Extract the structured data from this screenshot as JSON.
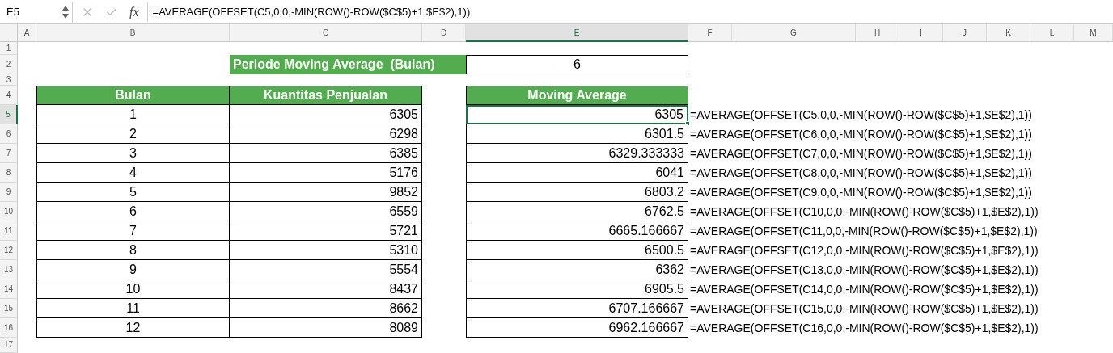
{
  "formula_bar": {
    "name_box": "E5",
    "fx": "fx",
    "formula": "=AVERAGE(OFFSET(C5,0,0,-MIN(ROW()-ROW($C$5)+1,$E$2),1))"
  },
  "columns": [
    {
      "label": "A",
      "selected": false
    },
    {
      "label": "B",
      "selected": false
    },
    {
      "label": "C",
      "selected": false
    },
    {
      "label": "D",
      "selected": false
    },
    {
      "label": "E",
      "selected": true
    },
    {
      "label": "F",
      "selected": false
    },
    {
      "label": "G",
      "selected": false
    },
    {
      "label": "H",
      "selected": false
    },
    {
      "label": "I",
      "selected": false
    },
    {
      "label": "J",
      "selected": false
    },
    {
      "label": "K",
      "selected": false
    },
    {
      "label": "L",
      "selected": false
    },
    {
      "label": "M",
      "selected": false
    }
  ],
  "row_numbers": [
    {
      "label": "1",
      "selected": false
    },
    {
      "label": "2",
      "selected": false
    },
    {
      "label": "3",
      "selected": false
    },
    {
      "label": "4",
      "selected": false
    },
    {
      "label": "5",
      "selected": true
    },
    {
      "label": "6",
      "selected": false
    },
    {
      "label": "7",
      "selected": false
    },
    {
      "label": "8",
      "selected": false
    },
    {
      "label": "9",
      "selected": false
    },
    {
      "label": "10",
      "selected": false
    },
    {
      "label": "11",
      "selected": false
    },
    {
      "label": "12",
      "selected": false
    },
    {
      "label": "13",
      "selected": false
    },
    {
      "label": "14",
      "selected": false
    },
    {
      "label": "15",
      "selected": false
    },
    {
      "label": "16",
      "selected": false
    },
    {
      "label": "17",
      "selected": false
    }
  ],
  "period": {
    "label": "Periode Moving Average  (Bulan)",
    "value": "6"
  },
  "sales_table": {
    "columns": [
      "Bulan",
      "Kuantitas Penjualan"
    ],
    "rows": [
      [
        "1",
        "6305"
      ],
      [
        "2",
        "6298"
      ],
      [
        "3",
        "6385"
      ],
      [
        "4",
        "5176"
      ],
      [
        "5",
        "9852"
      ],
      [
        "6",
        "6559"
      ],
      [
        "7",
        "5721"
      ],
      [
        "8",
        "5310"
      ],
      [
        "9",
        "5554"
      ],
      [
        "10",
        "8437"
      ],
      [
        "11",
        "8662"
      ],
      [
        "12",
        "8089"
      ]
    ]
  },
  "moving_average": {
    "header": "Moving Average",
    "rows": [
      {
        "value": "6305",
        "formula": "=AVERAGE(OFFSET(C5,0,0,-MIN(ROW()-ROW($C$5)+1,$E$2),1))",
        "selected": true
      },
      {
        "value": "6301.5",
        "formula": "=AVERAGE(OFFSET(C6,0,0,-MIN(ROW()-ROW($C$5)+1,$E$2),1))",
        "selected": false
      },
      {
        "value": "6329.333333",
        "formula": "=AVERAGE(OFFSET(C7,0,0,-MIN(ROW()-ROW($C$5)+1,$E$2),1))",
        "selected": false
      },
      {
        "value": "6041",
        "formula": "=AVERAGE(OFFSET(C8,0,0,-MIN(ROW()-ROW($C$5)+1,$E$2),1))",
        "selected": false
      },
      {
        "value": "6803.2",
        "formula": "=AVERAGE(OFFSET(C9,0,0,-MIN(ROW()-ROW($C$5)+1,$E$2),1))",
        "selected": false
      },
      {
        "value": "6762.5",
        "formula": "=AVERAGE(OFFSET(C10,0,0,-MIN(ROW()-ROW($C$5)+1,$E$2),1))",
        "selected": false
      },
      {
        "value": "6665.166667",
        "formula": "=AVERAGE(OFFSET(C11,0,0,-MIN(ROW()-ROW($C$5)+1,$E$2),1))",
        "selected": false
      },
      {
        "value": "6500.5",
        "formula": "=AVERAGE(OFFSET(C12,0,0,-MIN(ROW()-ROW($C$5)+1,$E$2),1))",
        "selected": false
      },
      {
        "value": "6362",
        "formula": "=AVERAGE(OFFSET(C13,0,0,-MIN(ROW()-ROW($C$5)+1,$E$2),1))",
        "selected": false
      },
      {
        "value": "6905.5",
        "formula": "=AVERAGE(OFFSET(C14,0,0,-MIN(ROW()-ROW($C$5)+1,$E$2),1))",
        "selected": false
      },
      {
        "value": "6707.166667",
        "formula": "=AVERAGE(OFFSET(C15,0,0,-MIN(ROW()-ROW($C$5)+1,$E$2),1))",
        "selected": false
      },
      {
        "value": "6962.166667",
        "formula": "=AVERAGE(OFFSET(C16,0,0,-MIN(ROW()-ROW($C$5)+1,$E$2),1))",
        "selected": false
      }
    ]
  }
}
